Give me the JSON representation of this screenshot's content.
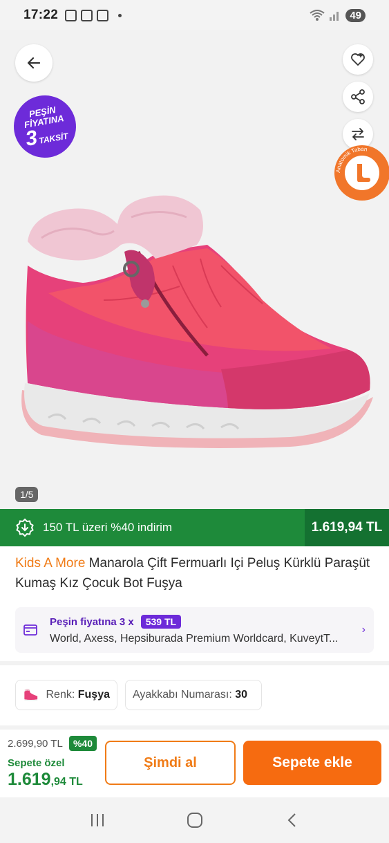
{
  "status_bar": {
    "time": "17:22",
    "battery": "49"
  },
  "gallery": {
    "badge_peshin": {
      "line1": "PEŞİN",
      "line2": "FİYATINA",
      "number": "3",
      "suffix": "TAKSİT"
    },
    "anatomic_badge": {
      "text": "Anatomik Taban"
    },
    "counter": "1/5",
    "icons": [
      "back-arrow-icon",
      "heart-icon",
      "share-icon",
      "compare-icon"
    ]
  },
  "promo": {
    "text": "150 TL üzeri %40 indirim",
    "price": "1.619,94 TL",
    "bg_color": "#1e8a3a"
  },
  "product": {
    "brand": "Kids A More",
    "name": " Manarola Çift Fermuarlı Içi Peluş Kürklü Paraşüt Kumaş Kız Çocuk Bot Fuşya"
  },
  "installment": {
    "label": "Peşin fiyatına 3 x",
    "amount": "539 TL",
    "banks": "World, Axess, Hepsiburada Premium Worldcard, KuveytT..."
  },
  "variants": {
    "color_label": "Renk:",
    "color_value": "Fuşya",
    "size_label": "Ayakkabı Numarası:",
    "size_value": "30"
  },
  "purchase": {
    "old_price": "2.699,90 TL",
    "discount": "%40",
    "special_label": "Sepete özel",
    "price_main": "1.619",
    "price_decimal": ",94 TL",
    "buy_now": "Şimdi al",
    "add_to_cart": "Sepete ekle",
    "accent_color": "#f66b10"
  }
}
